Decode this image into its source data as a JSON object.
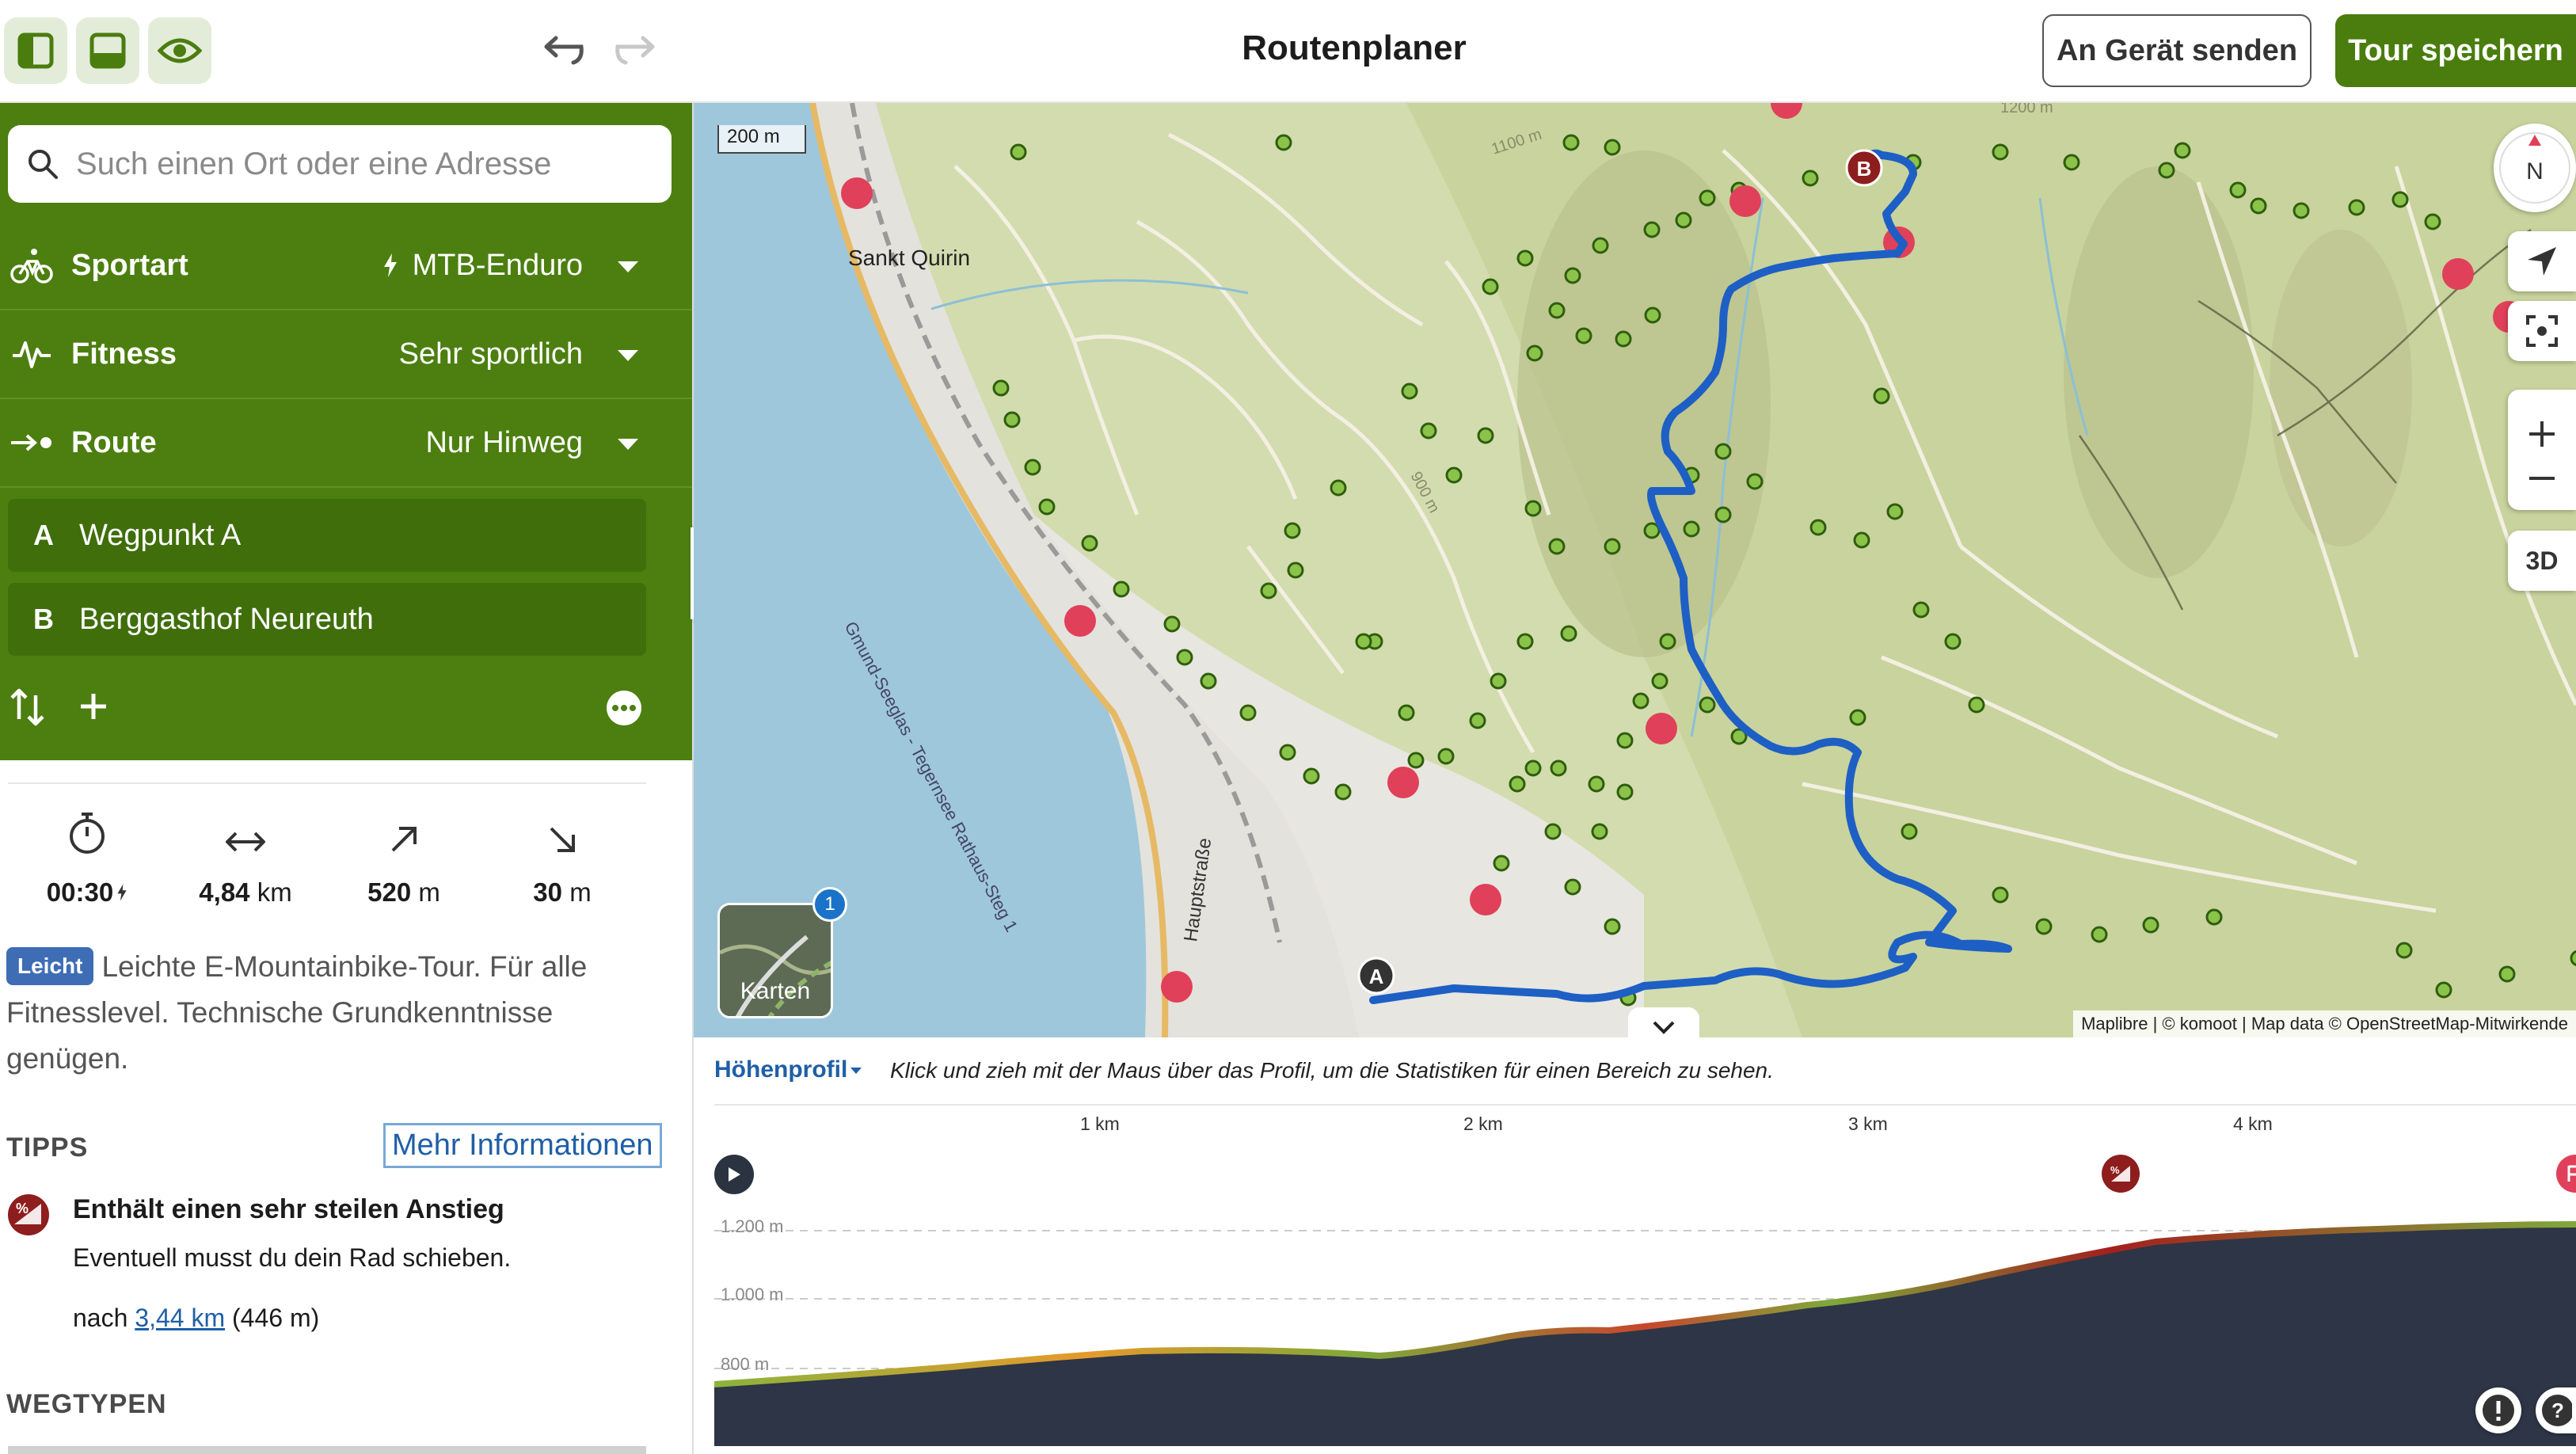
{
  "toolbar": {
    "title": "Routenplaner",
    "send_label": "An Gerät senden",
    "save_label": "Tour speichern"
  },
  "search": {
    "placeholder": "Such einen Ort oder eine Adresse"
  },
  "options": [
    {
      "label": "Sportart",
      "value": "MTB-Enduro"
    },
    {
      "label": "Fitness",
      "value": "Sehr sportlich"
    },
    {
      "label": "Route",
      "value": "Nur Hinweg"
    }
  ],
  "waypoints": [
    {
      "letter": "A",
      "name": "Wegpunkt A"
    },
    {
      "letter": "B",
      "name": "Berggasthof Neureuth"
    }
  ],
  "stats": {
    "duration": "00:30",
    "distance_value": "4,84",
    "distance_unit": "km",
    "ascent_value": "520",
    "ascent_unit": "m",
    "descent_value": "30",
    "descent_unit": "m"
  },
  "difficulty": {
    "badge": "Leicht",
    "text": "Leichte E-Mountainbike-Tour. Für alle Fitnesslevel. Technische Grundkenntnisse genügen."
  },
  "tips": {
    "heading": "TIPPS",
    "more_label": "Mehr Informationen",
    "title": "Enthält einen sehr steilen Anstieg",
    "subtitle": "Eventuell musst du dein Rad schieben.",
    "at_prefix": "nach",
    "at_link": "3,44 km",
    "at_suffix": "(446 m)"
  },
  "types_heading": "WEGTYPEN",
  "map": {
    "scale": "200 m",
    "place_label": "Sankt Quirin",
    "road_label": "Gmund-Seeglas - Tegernsee Rathaus-Steg 1",
    "street_label": "Hauptstraße",
    "contour_1100": "1100 m",
    "contour_1200": "1200 m",
    "contour_900": "900 m",
    "compass": "N",
    "btn_3d": "3D",
    "layers_label": "Karten",
    "layers_count": "1",
    "marker_a": "A",
    "marker_b": "B",
    "attribution": "Maplibre | © komoot | Map data © OpenStreetMap-Mitwirkende"
  },
  "elevation": {
    "title": "Höhenprofil",
    "hint": "Klick und zieh mit der Maus über das Profil, um die Statistiken für einen Bereich zu sehen.",
    "km_ticks": [
      "1 km",
      "2 km",
      "3 km",
      "4 km"
    ],
    "alt_ticks": [
      "1.200 m",
      "1.000 m",
      "800 m"
    ]
  },
  "colors": {
    "brand_green": "#4c7f10",
    "route_blue": "#1d5fc4",
    "badge_blue": "#3e6db6"
  }
}
